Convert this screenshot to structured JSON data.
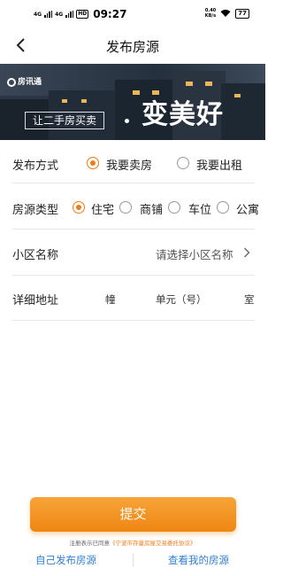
{
  "status_bar": {
    "network1": "4G",
    "network2": "4G",
    "hd": "HD",
    "time": "09:27",
    "speed_value": "0.40",
    "speed_unit": "KB/s",
    "battery": "77"
  },
  "nav": {
    "title": "发布房源"
  },
  "banner": {
    "logo_text": "房讯通",
    "tagline": "让二手房买卖",
    "slogan": "变美好"
  },
  "form": {
    "publish_type": {
      "label": "发布方式",
      "options": [
        {
          "label": "我要卖房",
          "selected": true
        },
        {
          "label": "我要出租",
          "selected": false
        }
      ]
    },
    "property_type": {
      "label": "房源类型",
      "options": [
        {
          "label": "住宅",
          "selected": true
        },
        {
          "label": "商铺",
          "selected": false
        },
        {
          "label": "车位",
          "selected": false
        },
        {
          "label": "公寓",
          "selected": false
        }
      ]
    },
    "community": {
      "label": "小区名称",
      "placeholder": "请选择小区名称"
    },
    "address": {
      "label": "详细地址",
      "building_unit": "幢",
      "unit_unit": "单元（号）",
      "room_unit": "室"
    }
  },
  "actions": {
    "submit_label": "提交",
    "agreement_prefix": "注册表示已同意",
    "agreement_link": "《宁波市存量房屋交易委托协议》",
    "self_publish": "自己发布房源",
    "view_mine": "查看我的房源"
  },
  "colors": {
    "accent": "#f07b17",
    "link": "#2f7fd1"
  }
}
